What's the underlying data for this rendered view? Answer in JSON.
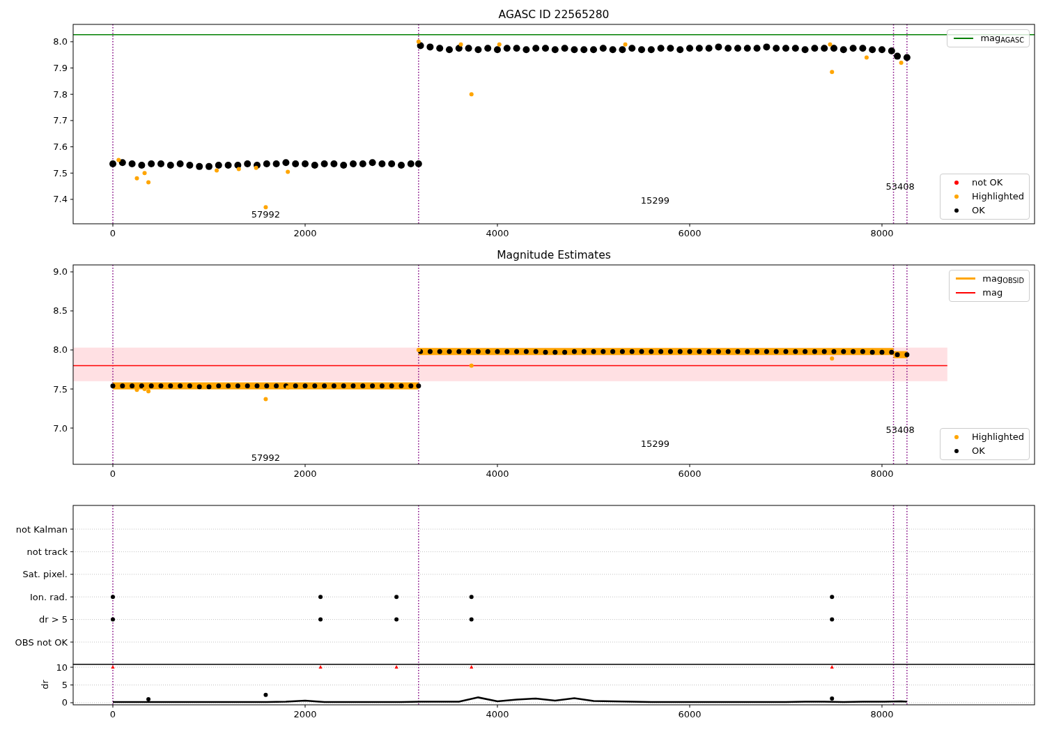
{
  "figure": {
    "panels": [
      {
        "chart_data": {
          "type": "scatter",
          "title": "AGASC ID 22565280",
          "xlim": [
            -413,
            9587
          ],
          "ylim": [
            7.307,
            8.066
          ],
          "xticks": [
            0,
            2000,
            4000,
            6000,
            8000
          ],
          "yticks": [
            {
              "value": 7.4,
              "label": "7.4"
            },
            {
              "value": 7.5,
              "label": "7.5"
            },
            {
              "value": 7.6,
              "label": "7.6"
            },
            {
              "value": 7.7,
              "label": "7.7"
            },
            {
              "value": 7.8,
              "label": "7.8"
            },
            {
              "value": 7.9,
              "label": "7.9"
            },
            {
              "value": 8.0,
              "label": "8.0"
            }
          ],
          "legend": [
            "upper right",
            "lower right"
          ],
          "series": [
            {
              "name": "mag$_{AGASC}$",
              "type": "line",
              "color": "#008000",
              "x": [
                -413,
                9587
              ],
              "values": [
                8.027,
                8.027
              ]
            },
            {
              "name": "not OK",
              "type": "scatter",
              "marker": "circle",
              "color": "#ff0000"
            },
            {
              "name": "Highlighted",
              "type": "scatter",
              "marker": "circle",
              "color": "#ffa500",
              "x": [
                60,
                250,
                330,
                370,
                1080,
                1310,
                1490,
                1590,
                1820,
                3180,
                3620,
                3730,
                4020,
                5330,
                7460,
                7480,
                7840,
                8200
              ],
              "values": [
                7.55,
                7.48,
                7.5,
                7.465,
                7.51,
                7.515,
                7.52,
                7.37,
                7.505,
                8.0,
                7.99,
                7.8,
                7.99,
                7.99,
                7.99,
                7.885,
                7.94,
                7.92
              ]
            },
            {
              "name": "OK",
              "type": "scatter",
              "marker": "circle",
              "color": "#000000",
              "x": [
                0,
                100,
                200,
                300,
                400,
                500,
                600,
                700,
                800,
                900,
                1000,
                1100,
                1200,
                1300,
                1400,
                1500,
                1600,
                1700,
                1800,
                1900,
                2000,
                2100,
                2200,
                2300,
                2400,
                2500,
                2600,
                2700,
                2800,
                2900,
                3000,
                3100,
                3180,
                3200,
                3300,
                3400,
                3500,
                3600,
                3700,
                3800,
                3900,
                4000,
                4100,
                4200,
                4300,
                4400,
                4500,
                4600,
                4700,
                4800,
                4900,
                5000,
                5100,
                5200,
                5300,
                5400,
                5500,
                5600,
                5700,
                5800,
                5900,
                6000,
                6100,
                6200,
                6300,
                6400,
                6500,
                6600,
                6700,
                6800,
                6900,
                7000,
                7100,
                7200,
                7300,
                7400,
                7500,
                7600,
                7700,
                7800,
                7900,
                8000,
                8100,
                8160,
                8260
              ],
              "values": [
                7.535,
                7.54,
                7.535,
                7.53,
                7.535,
                7.535,
                7.53,
                7.535,
                7.53,
                7.525,
                7.525,
                7.53,
                7.53,
                7.53,
                7.535,
                7.53,
                7.535,
                7.535,
                7.54,
                7.535,
                7.535,
                7.53,
                7.535,
                7.535,
                7.53,
                7.535,
                7.535,
                7.54,
                7.535,
                7.535,
                7.53,
                7.535,
                7.535,
                7.985,
                7.98,
                7.975,
                7.97,
                7.975,
                7.975,
                7.97,
                7.975,
                7.97,
                7.975,
                7.975,
                7.97,
                7.975,
                7.975,
                7.97,
                7.975,
                7.97,
                7.97,
                7.97,
                7.975,
                7.97,
                7.97,
                7.975,
                7.97,
                7.97,
                7.975,
                7.975,
                7.97,
                7.975,
                7.975,
                7.975,
                7.98,
                7.975,
                7.975,
                7.975,
                7.975,
                7.98,
                7.975,
                7.975,
                7.975,
                7.97,
                7.975,
                7.975,
                7.975,
                7.97,
                7.975,
                7.975,
                7.97,
                7.97,
                7.965,
                7.945,
                7.94
              ]
            }
          ],
          "ref_lines": [
            {
              "axis": "x",
              "value": 0
            },
            {
              "axis": "x",
              "value": 3180
            },
            {
              "axis": "x",
              "value": 8120
            },
            {
              "axis": "x",
              "value": 8260
            }
          ],
          "annotations": [
            "57992",
            "15299",
            "53408"
          ]
        }
      },
      {
        "chart_data": {
          "type": "scatter",
          "title": "Magnitude Estimates",
          "xlim": [
            -413,
            9587
          ],
          "ylim": [
            6.536,
            9.089
          ],
          "xticks": [
            0,
            2000,
            4000,
            6000,
            8000
          ],
          "yticks": [
            {
              "value": 7.0,
              "label": "7.0"
            },
            {
              "value": 7.5,
              "label": "7.5"
            },
            {
              "value": 8.0,
              "label": "8.0"
            },
            {
              "value": 8.5,
              "label": "8.5"
            },
            {
              "value": 9.0,
              "label": "9.0"
            }
          ],
          "legend": [
            "upper right",
            "lower right"
          ],
          "bands": [
            {
              "axis": "y",
              "from": 7.6,
              "to": 8.03,
              "color": "#ffe0e3"
            }
          ],
          "series": [
            {
              "name": "mag$_{OBSID}$",
              "type": "line",
              "color": "#ffa500",
              "x": [
                0,
                3180,
                3180,
                8120,
                8120,
                8260
              ],
              "values": [
                7.54,
                7.54,
                7.98,
                7.98,
                7.94,
                7.94
              ]
            },
            {
              "name": "mag",
              "type": "line",
              "color": "#ff0000",
              "x": [
                -413,
                8680
              ],
              "values": [
                7.8,
                7.8
              ]
            },
            {
              "name": "Highlighted",
              "type": "scatter",
              "marker": "circle",
              "color": "#ffa500",
              "x": [
                250,
                330,
                370,
                1590,
                1820,
                3180,
                3730,
                7480
              ],
              "values": [
                7.49,
                7.5,
                7.47,
                7.37,
                7.52,
                8.0,
                7.8,
                7.89
              ]
            },
            {
              "name": "OK",
              "type": "scatter",
              "marker": "circle",
              "color": "#000000",
              "x": [
                0,
                100,
                200,
                300,
                400,
                500,
                600,
                700,
                800,
                900,
                1000,
                1100,
                1200,
                1300,
                1400,
                1500,
                1600,
                1700,
                1800,
                1900,
                2000,
                2100,
                2200,
                2300,
                2400,
                2500,
                2600,
                2700,
                2800,
                2900,
                3000,
                3100,
                3180,
                3200,
                3300,
                3400,
                3500,
                3600,
                3700,
                3800,
                3900,
                4000,
                4100,
                4200,
                4300,
                4400,
                4500,
                4600,
                4700,
                4800,
                4900,
                5000,
                5100,
                5200,
                5300,
                5400,
                5500,
                5600,
                5700,
                5800,
                5900,
                6000,
                6100,
                6200,
                6300,
                6400,
                6500,
                6600,
                6700,
                6800,
                6900,
                7000,
                7100,
                7200,
                7300,
                7400,
                7500,
                7600,
                7700,
                7800,
                7900,
                8000,
                8100,
                8160,
                8260
              ],
              "values": [
                7.54,
                7.54,
                7.54,
                7.54,
                7.54,
                7.54,
                7.54,
                7.54,
                7.54,
                7.53,
                7.53,
                7.54,
                7.54,
                7.54,
                7.54,
                7.54,
                7.54,
                7.54,
                7.54,
                7.54,
                7.54,
                7.54,
                7.54,
                7.54,
                7.54,
                7.54,
                7.54,
                7.54,
                7.54,
                7.54,
                7.54,
                7.54,
                7.54,
                7.98,
                7.98,
                7.98,
                7.98,
                7.98,
                7.98,
                7.98,
                7.98,
                7.98,
                7.98,
                7.98,
                7.98,
                7.98,
                7.97,
                7.97,
                7.97,
                7.98,
                7.98,
                7.98,
                7.98,
                7.98,
                7.98,
                7.98,
                7.98,
                7.98,
                7.98,
                7.98,
                7.98,
                7.98,
                7.98,
                7.98,
                7.98,
                7.98,
                7.98,
                7.98,
                7.98,
                7.98,
                7.98,
                7.98,
                7.98,
                7.98,
                7.98,
                7.98,
                7.98,
                7.98,
                7.98,
                7.98,
                7.97,
                7.97,
                7.97,
                7.94,
                7.94
              ]
            }
          ],
          "ref_lines": [
            {
              "axis": "x",
              "value": 0
            },
            {
              "axis": "x",
              "value": 3180
            },
            {
              "axis": "x",
              "value": 8120
            },
            {
              "axis": "x",
              "value": 8260
            }
          ],
          "annotations": [
            "57992",
            "15299",
            "53408"
          ]
        }
      },
      {
        "chart_data": {
          "type": "scatter",
          "orientation": "horizontal",
          "xlim": [
            -413,
            9587
          ],
          "grid": true,
          "categories": [
            "not Kalman",
            "not track",
            "Sat. pixel.",
            "Ion. rad.",
            "dr > 5",
            "OBS not OK"
          ],
          "series": [
            {
              "type": "scatter",
              "marker": "circle",
              "color": "#000000",
              "values": [
                null,
                null,
                null,
                0,
                0,
                null
              ]
            },
            {
              "type": "scatter",
              "marker": "circle",
              "color": "#000000",
              "values": [
                null,
                null,
                null,
                2160,
                2160,
                null
              ]
            },
            {
              "type": "scatter",
              "marker": "circle",
              "color": "#000000",
              "values": [
                null,
                null,
                null,
                2950,
                2950,
                null
              ]
            },
            {
              "type": "scatter",
              "marker": "circle",
              "color": "#000000",
              "values": [
                null,
                null,
                null,
                3730,
                3730,
                null
              ]
            },
            {
              "type": "scatter",
              "marker": "circle",
              "color": "#000000",
              "values": [
                null,
                null,
                null,
                7480,
                7480,
                null
              ]
            }
          ],
          "ref_lines": [
            {
              "axis": "x",
              "value": 0
            },
            {
              "axis": "x",
              "value": 3180
            },
            {
              "axis": "x",
              "value": 8120
            },
            {
              "axis": "x",
              "value": 8260
            }
          ]
        }
      },
      {
        "chart_data": {
          "type": "scatter",
          "ylabel": "dr",
          "xlim": [
            -413,
            9587
          ],
          "ylim": [
            -0.59,
            10.8
          ],
          "grid": true,
          "xticks": [
            0,
            2000,
            4000,
            6000,
            8000
          ],
          "yticks": [
            0,
            5,
            10
          ],
          "series": [
            {
              "type": "line",
              "color": "#000000",
              "x": [
                0,
                200,
                400,
                600,
                800,
                1000,
                1200,
                1400,
                1600,
                1800,
                2000,
                2200,
                2400,
                2600,
                2800,
                3000,
                3200,
                3400,
                3600,
                3800,
                4000,
                4200,
                4400,
                4600,
                4800,
                5000,
                5200,
                5400,
                5600,
                5800,
                6000,
                6200,
                6400,
                6600,
                6800,
                7000,
                7200,
                7400,
                7600,
                7800,
                8000,
                8200,
                8260
              ],
              "values": [
                0.2,
                0.2,
                0.2,
                0.2,
                0.2,
                0.2,
                0.2,
                0.2,
                0.2,
                0.3,
                0.6,
                0.2,
                0.2,
                0.2,
                0.2,
                0.2,
                0.3,
                0.3,
                0.3,
                1.5,
                0.4,
                0.9,
                1.2,
                0.6,
                1.3,
                0.5,
                0.4,
                0.3,
                0.2,
                0.2,
                0.2,
                0.2,
                0.2,
                0.2,
                0.2,
                0.2,
                0.3,
                0.3,
                0.2,
                0.3,
                0.3,
                0.4,
                0.3
              ]
            },
            {
              "type": "scatter",
              "marker": "circle",
              "color": "#000000",
              "x": [
                370,
                1590,
                7480
              ],
              "values": [
                1.0,
                2.2,
                1.2
              ]
            },
            {
              "type": "scatter",
              "marker": "triangle",
              "color": "#ff0000",
              "x": [
                0,
                2160,
                2950,
                3730,
                7480
              ],
              "values": [
                10,
                10,
                10,
                10,
                10
              ]
            }
          ],
          "ref_lines": [
            {
              "axis": "x",
              "value": 0
            },
            {
              "axis": "x",
              "value": 3180
            },
            {
              "axis": "x",
              "value": 8120
            },
            {
              "axis": "x",
              "value": 8260
            }
          ]
        }
      }
    ]
  }
}
